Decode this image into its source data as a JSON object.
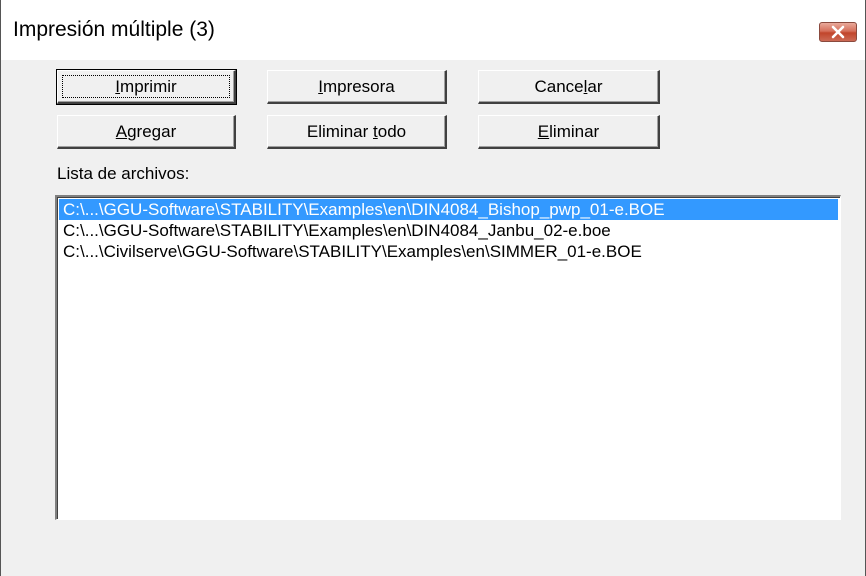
{
  "window": {
    "title": "Impresión múltiple (3)",
    "close_icon": "close-icon"
  },
  "buttons": {
    "imprimir": {
      "pre": "",
      "key": "I",
      "post": "mprimir"
    },
    "impresora": {
      "pre": "",
      "key": "I",
      "post": "mpresora"
    },
    "cancelar": {
      "pre": "Cance",
      "key": "l",
      "post": "ar"
    },
    "agregar": {
      "pre": "",
      "key": "A",
      "post": "gregar"
    },
    "eliminar_todo": {
      "pre": "Eliminar ",
      "key": "t",
      "post": "odo"
    },
    "eliminar": {
      "pre": "",
      "key": "E",
      "post": "liminar"
    }
  },
  "file_list": {
    "label": "Lista de archivos:",
    "items": [
      "C:\\...\\GGU-Software\\STABILITY\\Examples\\en\\DIN4084_Bishop_pwp_01-e.BOE",
      "C:\\...\\GGU-Software\\STABILITY\\Examples\\en\\DIN4084_Janbu_02-e.boe",
      "C:\\...\\Civilserve\\GGU-Software\\STABILITY\\Examples\\en\\SIMMER_01-e.BOE"
    ],
    "selected_index": 0
  },
  "colors": {
    "selection": "#3399ff",
    "close_button": "#c1452b"
  }
}
